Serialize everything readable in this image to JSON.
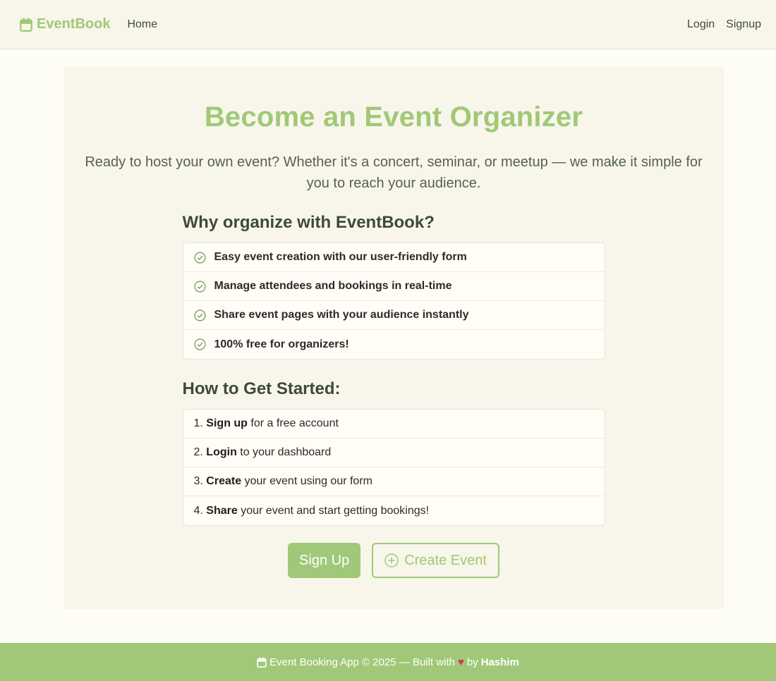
{
  "navbar": {
    "brand": "EventBook",
    "home": "Home",
    "login": "Login",
    "signup": "Signup"
  },
  "hero": {
    "title": "Become an Event Organizer",
    "lead": "Ready to host your own event? Whether it's a concert, seminar, or meetup — we make it simple for you to reach your audience."
  },
  "why": {
    "title": "Why organize with EventBook?",
    "items": [
      "Easy event creation with our user-friendly form",
      "Manage attendees and bookings in real-time",
      "Share event pages with your audience instantly",
      "100% free for organizers!"
    ]
  },
  "steps": {
    "title": "How to Get Started:",
    "items": [
      {
        "num": "1.",
        "bold": "Sign up",
        "rest": "for a free account"
      },
      {
        "num": "2.",
        "bold": "Login",
        "rest": "to your dashboard"
      },
      {
        "num": "3.",
        "bold": "Create",
        "rest": "your event using our form"
      },
      {
        "num": "4.",
        "bold": "Share",
        "rest": "your event and start getting bookings!"
      }
    ]
  },
  "actions": {
    "signup": "Sign Up",
    "create": "Create Event"
  },
  "footer": {
    "text": "Event Booking App © 2025 — Built with",
    "heart": "♥",
    "by": "by",
    "author": "Hashim"
  },
  "colors": {
    "accent": "#a0c878",
    "heart": "#d9344f"
  }
}
